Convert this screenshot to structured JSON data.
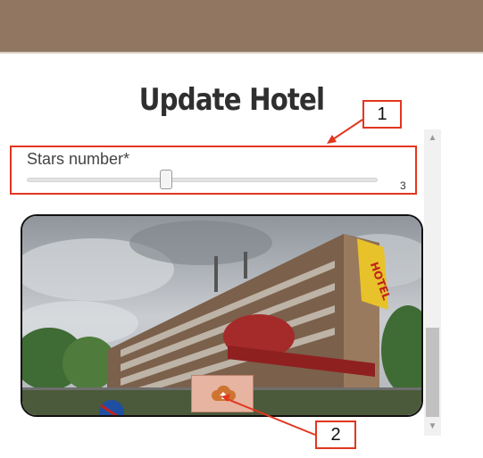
{
  "page": {
    "title": "Update Hotel"
  },
  "stars": {
    "label": "Stars number*",
    "value": "3",
    "slider_min": 1,
    "slider_max": 5,
    "slider_level": 3
  },
  "photo": {
    "sign_text": "HOTEL",
    "upload_icon": "cloud-upload-icon"
  },
  "annotations": {
    "callout_1": "1",
    "callout_2": "2"
  },
  "colors": {
    "header": "#917761",
    "callout_border": "#e2361f",
    "upload_button": "#e6b4a1",
    "upload_icon": "#cf7430"
  }
}
